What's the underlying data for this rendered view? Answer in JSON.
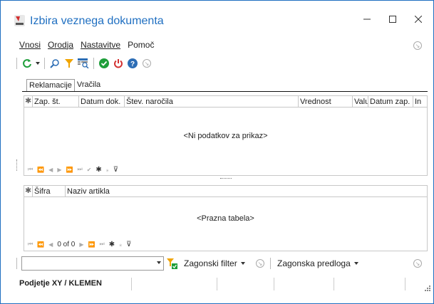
{
  "window": {
    "title": "Izbira veznega dokumenta"
  },
  "menu": {
    "items": [
      "Vnosi",
      "Orodja",
      "Nastavitve",
      "Pomoč"
    ]
  },
  "tabs": [
    "Reklamacije",
    "Vračila"
  ],
  "top_grid": {
    "columns": [
      "Zap. št.",
      "Datum dok.",
      "Štev. naročila",
      "Vrednost",
      "Valu",
      "Datum zap.",
      "In"
    ],
    "empty_text": "<Ni podatkov za prikaz>"
  },
  "bottom_grid": {
    "columns": [
      "Šifra",
      "Naziv artikla"
    ],
    "empty_text": "<Prazna tabela>",
    "nav_text": "0 of 0"
  },
  "filter": {
    "label": "Zagonski filter",
    "template_label": "Zagonska predloga"
  },
  "status": {
    "text": "Podjetje  XY / KLEMEN"
  },
  "colors": {
    "accent": "#1f6fc1",
    "ok": "#1e9e3a",
    "power": "#d32f2f",
    "help": "#2c6db5",
    "filter": "#f0a400"
  }
}
